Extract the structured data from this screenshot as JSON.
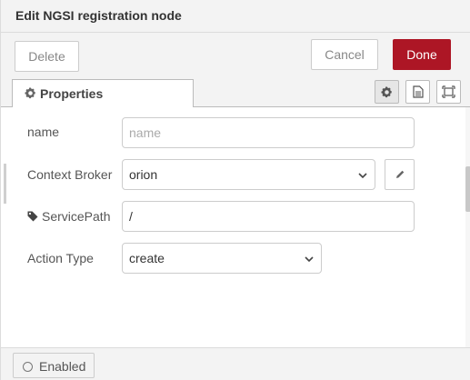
{
  "header": {
    "title": "Edit NGSI registration node"
  },
  "toolbar": {
    "delete_label": "Delete",
    "cancel_label": "Cancel",
    "done_label": "Done"
  },
  "tabs": [
    {
      "label": "Properties",
      "icon": "gear-icon",
      "active": true
    }
  ],
  "tab_icons": [
    "gear-icon",
    "document-icon",
    "frame-icon"
  ],
  "form": {
    "name": {
      "label": "name",
      "value": "",
      "placeholder": "name"
    },
    "context_broker": {
      "label": "Context Broker",
      "value": "orion"
    },
    "service_path": {
      "label": "ServicePath",
      "value": "/"
    },
    "action_type": {
      "label": "Action Type",
      "value": "create"
    }
  },
  "footer": {
    "enabled_label": "Enabled"
  },
  "colors": {
    "accent": "#ad1625",
    "panel": "#f3f3f3",
    "border": "#cccccc"
  }
}
